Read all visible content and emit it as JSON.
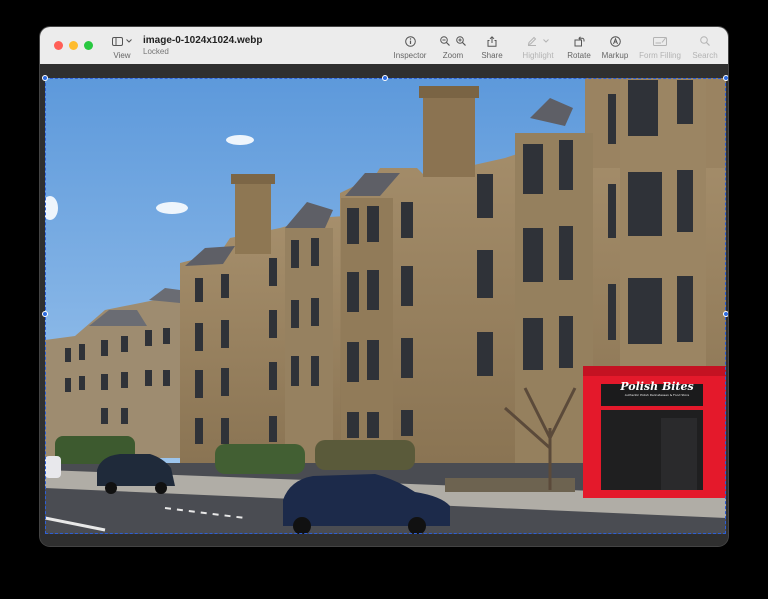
{
  "window": {
    "file_name": "image-0-1024x1024.webp",
    "status": "Locked"
  },
  "toolbar": {
    "view": "View",
    "inspector": "Inspector",
    "zoom": "Zoom",
    "share": "Share",
    "highlight": "Highlight",
    "rotate": "Rotate",
    "markup": "Markup",
    "form_filling": "Form Filling",
    "search": "Search"
  },
  "photo": {
    "shop_name": "Polish Bites",
    "shop_tagline": "Authentic Polish Delicatessen & Food Store"
  },
  "colors": {
    "selection": "#2d5fd6",
    "shopfront": "#e4192b",
    "sky": "#7fb2e6"
  }
}
